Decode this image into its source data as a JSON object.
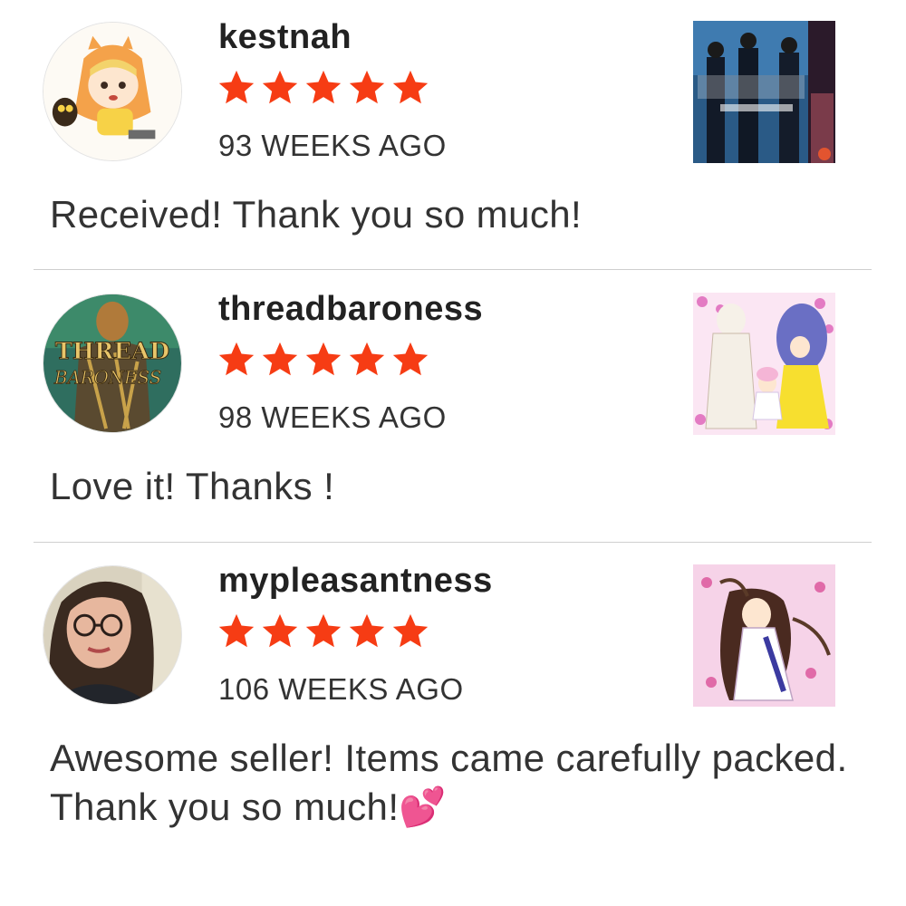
{
  "reviews": [
    {
      "username": "kestnah",
      "rating": 5,
      "time": "93 WEEKS AGO",
      "comment": "Received! Thank you so much!",
      "avatar_icon": "cartoon-girl-avatar-icon",
      "thumbnail_icon": "seven-days-manga-cover-icon"
    },
    {
      "username": "threadbaroness",
      "rating": 5,
      "time": "98 WEEKS AGO",
      "comment": "Love it! Thanks !",
      "avatar_icon": "thread-baroness-logo-icon",
      "avatar_text_line1": "THREAD",
      "avatar_text_line2": "BARONESS",
      "thumbnail_icon": "sailor-moon-art-icon"
    },
    {
      "username": "mypleasantness",
      "rating": 5,
      "time": "106 WEEKS AGO",
      "comment": "Awesome seller! Items came carefully packed. Thank you so much!💕",
      "avatar_icon": "user-photo-avatar-icon",
      "thumbnail_icon": "anime-illustration-icon"
    }
  ],
  "colors": {
    "star": "#f63c14",
    "divider": "#cfcfcf",
    "text": "#222222"
  }
}
